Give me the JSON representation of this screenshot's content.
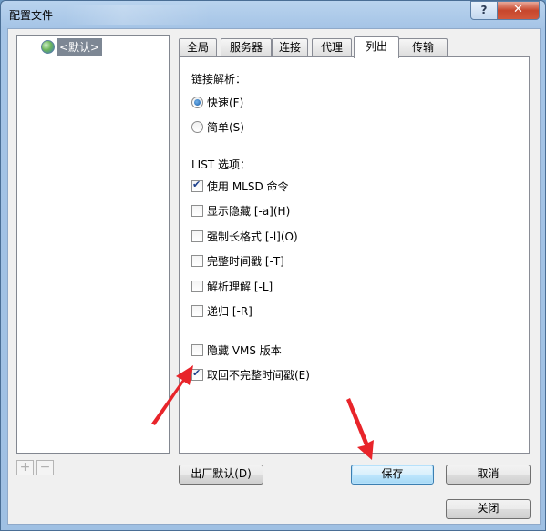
{
  "window": {
    "title": "配置文件",
    "help_glyph": "?",
    "close_glyph": "✕"
  },
  "tree": {
    "items": [
      {
        "label": "<默认>"
      }
    ]
  },
  "tree_buttons": {
    "add_glyph": "+",
    "remove_glyph": "−"
  },
  "tabs": [
    {
      "label": "全局"
    },
    {
      "label": "服务器"
    },
    {
      "label": "连接"
    },
    {
      "label": "代理"
    },
    {
      "label": "列出",
      "active": true
    },
    {
      "label": "传输"
    }
  ],
  "listing": {
    "link_section": "链接解析：",
    "link_options": [
      {
        "label": "快速(F)",
        "selected": true
      },
      {
        "label": "简单(S)",
        "selected": false
      }
    ],
    "list_section": "LIST 选项：",
    "list_options": [
      {
        "label": "使用 MLSD 命令",
        "checked": true
      },
      {
        "label": "显示隐藏 [-a](H)",
        "checked": false
      },
      {
        "label": "强制长格式 [-l](O)",
        "checked": false
      },
      {
        "label": "完整时间戳 [-T]",
        "checked": false
      },
      {
        "label": "解析理解 [-L]",
        "checked": false
      },
      {
        "label": "递归 [-R]",
        "checked": false
      }
    ],
    "extra_options": [
      {
        "label": "隐藏 VMS 版本",
        "checked": false
      },
      {
        "label": "取回不完整时间戳(E)",
        "checked": true
      }
    ]
  },
  "buttons": {
    "factory_defaults": "出厂默认(D)",
    "save": "保存",
    "cancel": "取消",
    "close": "关闭"
  },
  "colors": {
    "annotation_arrow": "#e8242a",
    "selection": "#7d8794"
  }
}
